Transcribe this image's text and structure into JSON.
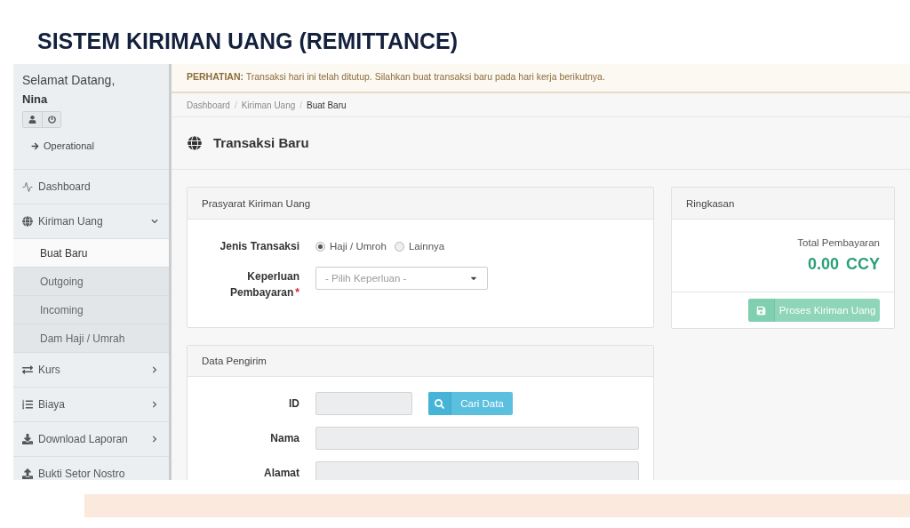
{
  "slide_title": "SISTEM KIRIMAN UANG (REMITTANCE)",
  "sidebar": {
    "greeting": "Selamat Datang,",
    "user_name": "Nina",
    "role_link": "Operational",
    "menu": [
      {
        "label": "Dashboard",
        "kind": "link",
        "selected": false
      },
      {
        "label": "Kiriman Uang",
        "kind": "group",
        "selected": false,
        "expanded": true,
        "children": [
          {
            "label": "Buat Baru",
            "selected": true
          },
          {
            "label": "Outgoing",
            "selected": false
          },
          {
            "label": "Incoming",
            "selected": false
          },
          {
            "label": "Dam Haji / Umrah",
            "selected": false
          }
        ]
      },
      {
        "label": "Kurs",
        "kind": "group",
        "selected": false,
        "expanded": false
      },
      {
        "label": "Biaya",
        "kind": "group",
        "selected": false,
        "expanded": false
      },
      {
        "label": "Download Laporan",
        "kind": "group",
        "selected": false,
        "expanded": false
      },
      {
        "label": "Bukti Setor Nostro",
        "kind": "link",
        "selected": false
      }
    ]
  },
  "alert": {
    "message": "**PERHATIAN:** Transaksi hari ini telah ditutup. Silahkan buat transaksi baru pada hari kerja berikutnya."
  },
  "breadcrumb": {
    "items": [
      {
        "label": "Dashboard",
        "current": false,
        "separator": "/"
      },
      {
        "label": "Kiriman Uang",
        "current": false,
        "separator": "/"
      },
      {
        "label": "Buat Baru",
        "current": true
      }
    ]
  },
  "page_title": "Transaksi Baru",
  "prerequisite_panel": {
    "title": "Prasyarat Kiriman Uang",
    "transaction_type": {
      "label": "Jenis Transaksi",
      "options": [
        {
          "label": "Haji / Umroh",
          "selected": true
        },
        {
          "label": "Lainnya",
          "selected": false
        }
      ]
    },
    "purpose": {
      "label": "Keperluan Pembayaran",
      "required_mark": "*",
      "placeholder": "- Pilih Keperluan -"
    }
  },
  "summary_panel": {
    "title": "Ringkasan",
    "total_label": "Total Pembayaran",
    "total_amount": "0.00",
    "currency": "CCY",
    "submit_button": {
      "label": "Proses Kiriman Uang",
      "disabled": true
    }
  },
  "sender_panel": {
    "title": "Data Pengirim",
    "fields": [
      {
        "label": "ID",
        "kind": "search",
        "disabled": true,
        "button": "Cari Data"
      },
      {
        "label": "Nama",
        "kind": "text",
        "disabled": true
      },
      {
        "label": "Alamat",
        "kind": "text",
        "disabled": true
      }
    ]
  }
}
